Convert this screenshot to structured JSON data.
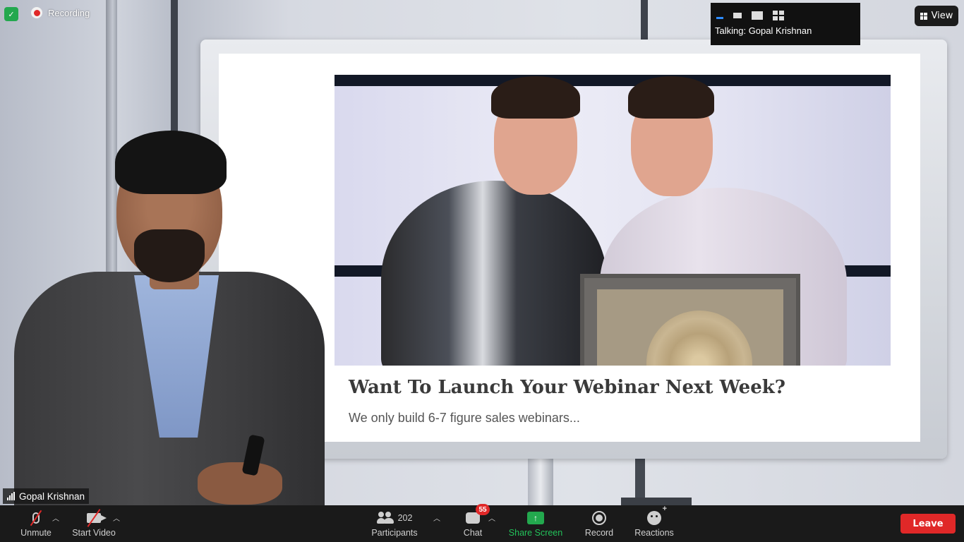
{
  "top": {
    "recording_label": "Recording",
    "view_label": "View",
    "talking_label": "Talking: Gopal Krishnan",
    "security_icon": "shield-check-icon",
    "layout_icons": [
      "minimize-icon",
      "small-layout-icon",
      "large-layout-icon",
      "gallery-icon"
    ]
  },
  "video": {
    "participant_name": "Gopal Krishnan"
  },
  "slide": {
    "headline": "Want To Launch Your Webinar Next Week?",
    "subheadline": "We only build 6-7 figure sales webinars..."
  },
  "toolbar": {
    "unmute_label": "Unmute",
    "start_video_label": "Start Video",
    "participants_label": "Participants",
    "participants_count": "202",
    "chat_label": "Chat",
    "chat_badge": "55",
    "share_label": "Share Screen",
    "record_label": "Record",
    "reactions_label": "Reactions",
    "leave_label": "Leave"
  },
  "colors": {
    "accent_green": "#23a84e",
    "leave_red": "#e02828",
    "badge_red": "#e02828",
    "toolbar_bg": "#1a1a1a",
    "active_blue": "#2d8cff"
  }
}
